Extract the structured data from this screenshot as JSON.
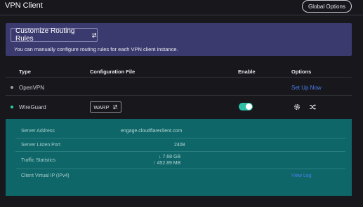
{
  "header": {
    "title": "VPN Client",
    "global_options_label": "Global Options"
  },
  "banner": {
    "button_label": "Customize Routing Rules",
    "button_icon": "swap-arrows-icon",
    "description": "You can manually configure routing rules for each VPN client instance."
  },
  "table": {
    "columns": [
      "Type",
      "Configuration File",
      "Enable",
      "Options"
    ],
    "rows": [
      {
        "status_color": "#9a9aa2",
        "type": "OpenVPN",
        "config": "",
        "action_label": "Set Up Now"
      },
      {
        "status_color": "#2fd0b0",
        "type": "WireGuard",
        "config": "WARP",
        "config_icon": "swap-arrows-icon",
        "enabled": true,
        "option_icons": [
          "gear-icon",
          "shuffle-icon"
        ]
      }
    ]
  },
  "details": {
    "server_address_label": "Server Address",
    "server_address": "engage.cloudflareclient.com",
    "server_port_label": "Server Listen Port",
    "server_port": "2408",
    "traffic_label": "Traffic Statistics",
    "traffic_down": "7.68 GB",
    "traffic_up": "452.89 MB",
    "virtual_ip_label": "Client Virtual IP (IPv4)",
    "view_log_label": "View Log"
  },
  "colors": {
    "background": "#17171c",
    "banner": "#3b3a6e",
    "panel": "#0e6668",
    "accent": "#2fbfa6",
    "link": "#4a7ef0"
  }
}
